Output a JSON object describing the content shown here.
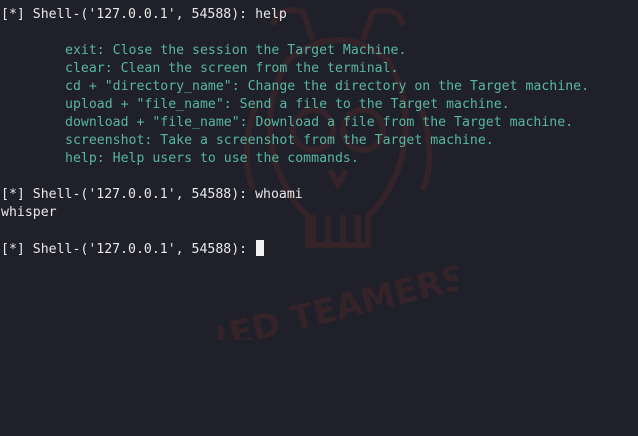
{
  "terminal": {
    "prompt": "[*] Shell-('127.0.0.1', 54588): ",
    "watermark_text": "RED TEAMERS",
    "sessions": [
      {
        "command": "help"
      },
      {
        "command": "whoami",
        "output": "whisper"
      },
      {
        "command": ""
      }
    ],
    "help_lines": [
      "exit: Close the session the Target Machine.",
      "clear: Clean the screen from the terminal.",
      "cd + \"directory_name\": Change the directory on the Target machine.",
      "upload + \"file_name\": Send a file to the Target machine.",
      "download + \"file_name\": Download a file from the Target machine.",
      "screenshot: Take a screenshot from the Target machine.",
      "help: Help users to use the commands."
    ],
    "colors": {
      "background": "#1f2029",
      "text": "#e8e8e8",
      "help_text": "#58b6a3",
      "watermark": "#c0392b"
    }
  }
}
